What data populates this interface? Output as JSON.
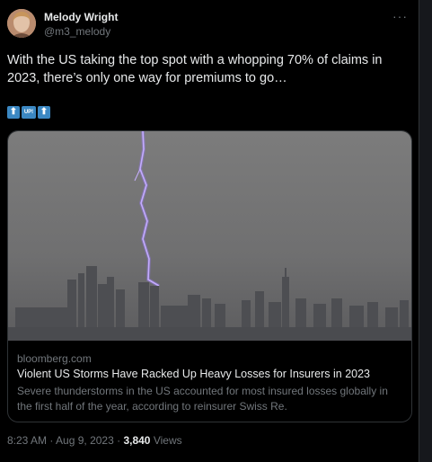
{
  "tweet": {
    "author_name": "Melody Wright",
    "author_handle": "@m3_melody",
    "more_icon": "more-horizontal-icon",
    "text": "With the US taking the top spot with a whopping 70% of claims in 2023, there’s only one way for premiums to go…",
    "emojis": [
      "⬆",
      "UP!",
      "⬆"
    ],
    "card": {
      "domain": "bloomberg.com",
      "title": "Violent US Storms Have Racked Up Heavy Losses for Insurers in 2023",
      "description": "Severe thunderstorms in the US accounted for most insured losses globally in the first half of the year, according to reinsurer Swiss Re."
    },
    "time": "8:23 AM",
    "separator": " · ",
    "date": "Aug 9, 2023",
    "views_count": "3,840",
    "views_label": " Views"
  }
}
